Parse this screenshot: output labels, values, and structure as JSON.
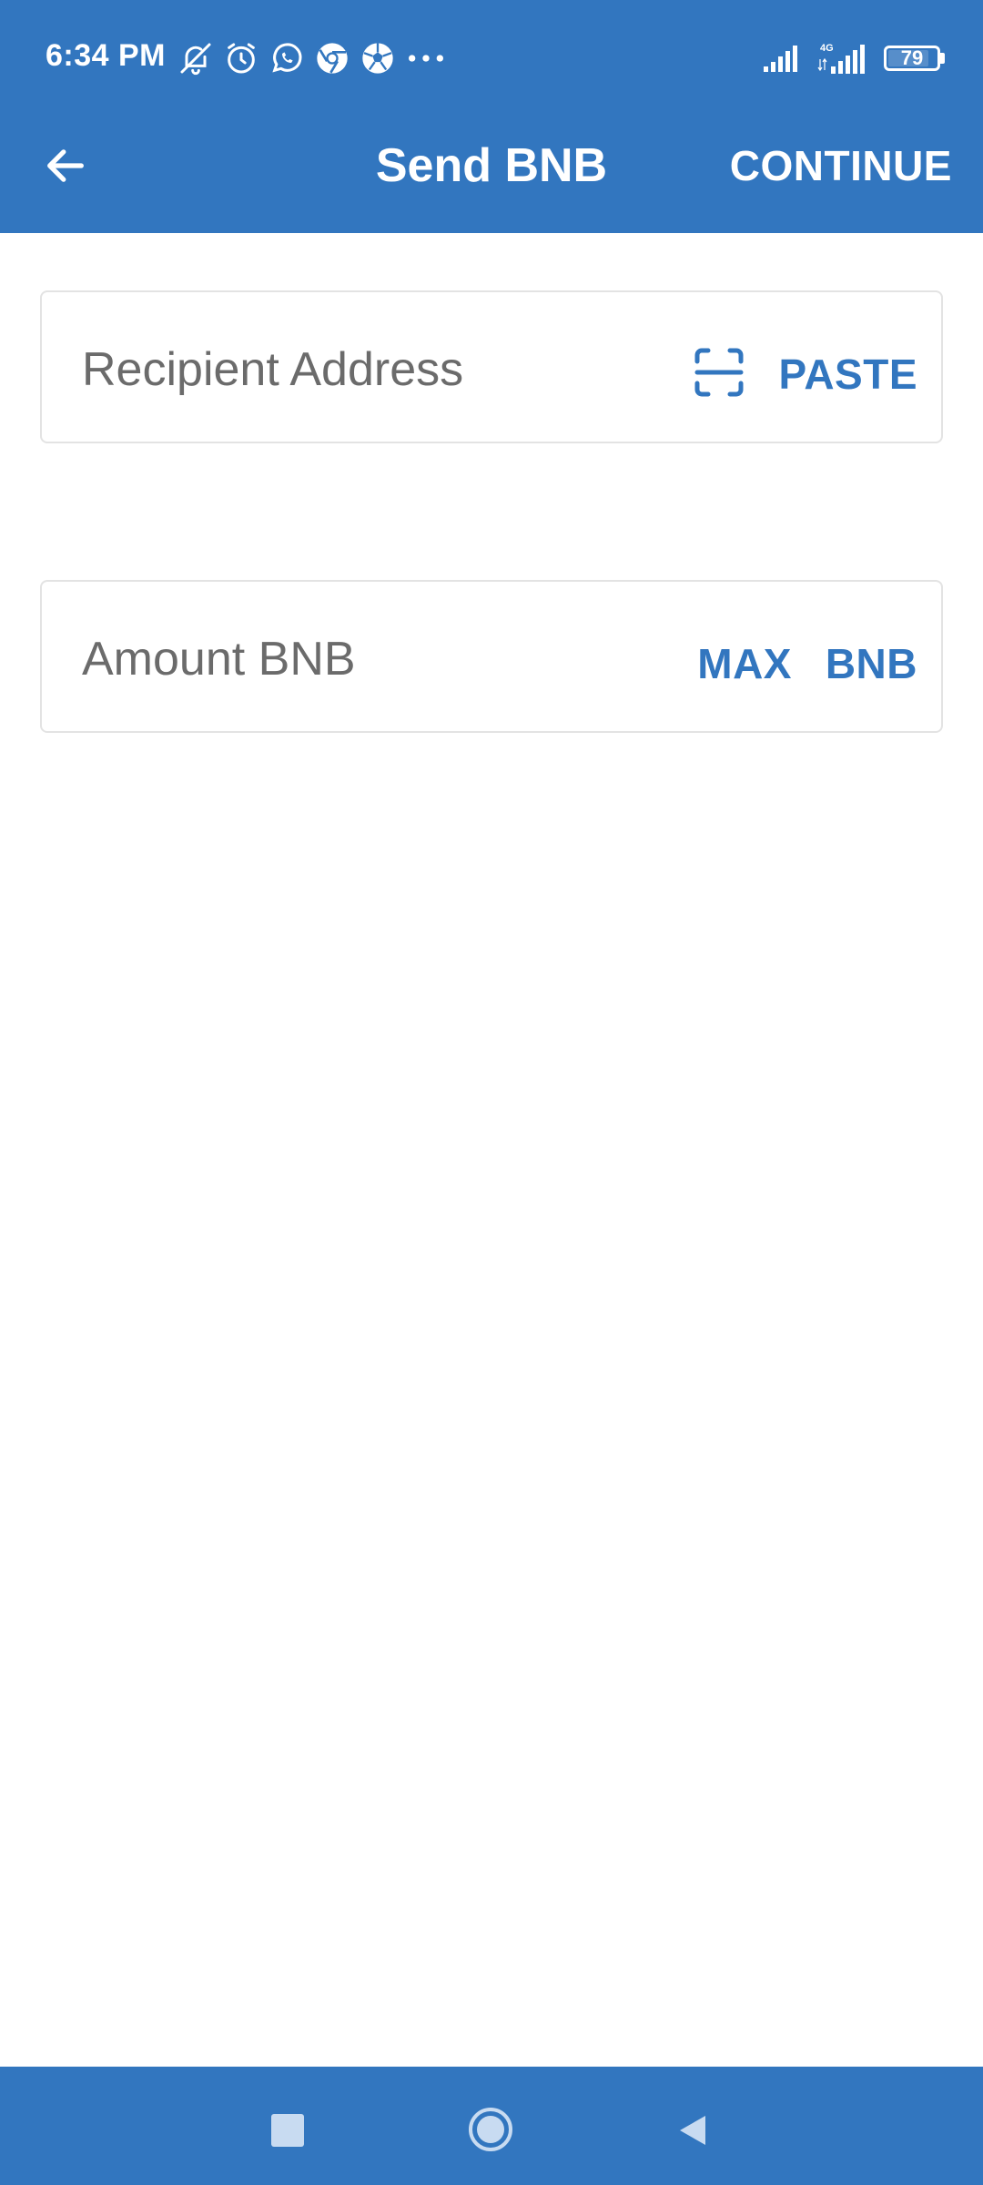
{
  "status_bar": {
    "time": "6:34 PM",
    "notification_icons": [
      "bell-off-icon",
      "alarm-icon",
      "whatsapp-icon",
      "chrome-icon",
      "football-icon",
      "more-dots-icon"
    ],
    "network_label": "4G",
    "battery_level": "79"
  },
  "app_bar": {
    "back_icon": "arrow-left-icon",
    "title": "Send BNB",
    "action_label": "CONTINUE"
  },
  "form": {
    "recipient": {
      "placeholder": "Recipient Address",
      "value": "",
      "scan_icon": "qr-scan-icon",
      "paste_label": "PASTE"
    },
    "amount": {
      "placeholder": "Amount BNB",
      "value": "",
      "max_label": "MAX",
      "currency_label": "BNB"
    }
  },
  "nav_bar": {
    "buttons": [
      "recents-square-icon",
      "home-circle-icon",
      "back-triangle-icon"
    ]
  },
  "colors": {
    "primary": "#3276bf",
    "background": "#ffffff",
    "field_border": "#e3e3e3",
    "placeholder": "#6b6b6b"
  }
}
